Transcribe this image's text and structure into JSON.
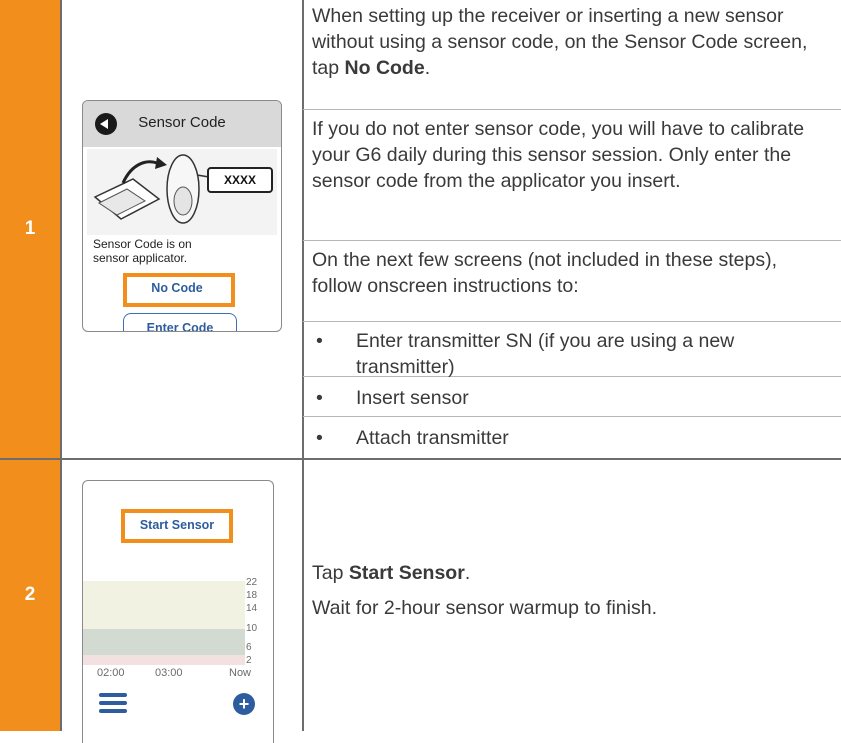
{
  "steps": [
    {
      "number": "1",
      "phone": {
        "header_title": "Sensor Code",
        "code_box": "XXXX",
        "caption_line1": "Sensor Code is on",
        "caption_line2": "sensor applicator.",
        "no_code_label": "No Code",
        "enter_code_label": "Enter Code"
      },
      "paragraphs": {
        "p1_pre": "When setting up the receiver or inserting a new sensor without using a sensor code, on the Sensor Code screen, tap ",
        "p1_bold": "No Code",
        "p1_post": ".",
        "p2": "If you do not enter sensor code, you will have to calibrate your G6 daily during this sensor session. Only enter the sensor code from the applicator you insert.",
        "p3": "On the next few screens (not included in these steps), follow onscreen instructions to:"
      },
      "bullets": [
        "Enter transmitter SN (if you are using a new transmitter)",
        "Insert sensor",
        "Attach transmitter"
      ]
    },
    {
      "number": "2",
      "phone": {
        "start_sensor_label": "Start Sensor",
        "y_ticks": [
          "22",
          "18",
          "14",
          "10",
          "6",
          "2"
        ],
        "x_ticks": [
          "02:00",
          "03:00",
          "Now"
        ]
      },
      "paragraphs": {
        "p1_pre": "Tap ",
        "p1_bold": "Start Sensor",
        "p1_post": ".",
        "p2": "Wait for 2-hour sensor warmup to finish."
      }
    }
  ],
  "colors": {
    "step_orange": "#f28e1c",
    "button_blue": "#2d5d9f",
    "chart_high_band": "#f1f2e1",
    "chart_target_band": "#d3dad2",
    "chart_low_band": "#f3e0e0"
  },
  "icons": [
    "back-arrow-icon",
    "menu-icon",
    "plus-icon",
    "sensor-applicator-illustration"
  ]
}
